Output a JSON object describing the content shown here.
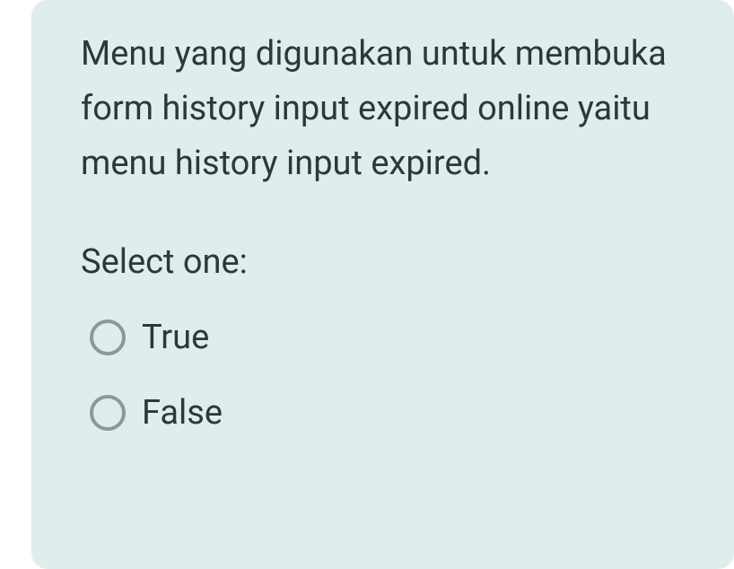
{
  "question": {
    "text": "Menu yang digunakan untuk membuka form history input expired online yaitu menu history input expired.",
    "prompt": "Select one:",
    "options": [
      {
        "label": "True"
      },
      {
        "label": "False"
      }
    ]
  }
}
